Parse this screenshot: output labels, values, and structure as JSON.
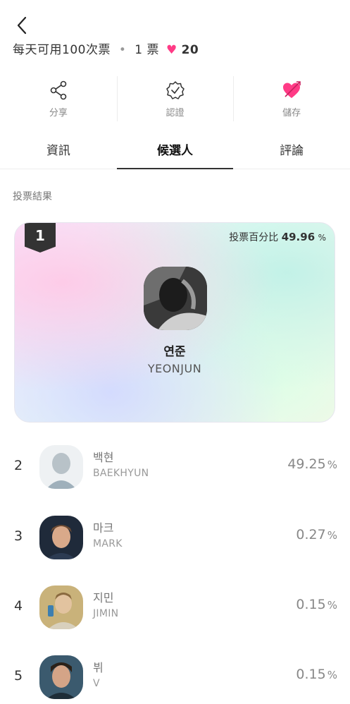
{
  "header": {
    "info_text": "每天可用100次票",
    "ticket_text": "1 票",
    "heart_count": "20"
  },
  "actions": [
    {
      "label": "分享",
      "icon": "share-icon"
    },
    {
      "label": "認證",
      "icon": "verified-badge-icon"
    },
    {
      "label": "儲存",
      "icon": "heart-arrow-icon"
    }
  ],
  "tabs": [
    {
      "label": "資訊",
      "active": false
    },
    {
      "label": "候選人",
      "active": true
    },
    {
      "label": "評論",
      "active": false
    }
  ],
  "section_title": "投票結果",
  "winner": {
    "rank": "1",
    "percent_label": "投票百分比",
    "percent": "49.96",
    "unit": "%",
    "name": "연준",
    "eng": "YEONJUN"
  },
  "candidates": [
    {
      "rank": "2",
      "name": "백현",
      "eng": "BAEKHYUN",
      "percent": "49.25",
      "unit": "%"
    },
    {
      "rank": "3",
      "name": "마크",
      "eng": "MARK",
      "percent": "0.27",
      "unit": "%"
    },
    {
      "rank": "4",
      "name": "지민",
      "eng": "JIMIN",
      "percent": "0.15",
      "unit": "%"
    },
    {
      "rank": "5",
      "name": "뷔",
      "eng": "V",
      "percent": "0.15",
      "unit": "%"
    }
  ],
  "colors": {
    "accent_pink": "#ff3b86",
    "active_tab": "#333333"
  }
}
